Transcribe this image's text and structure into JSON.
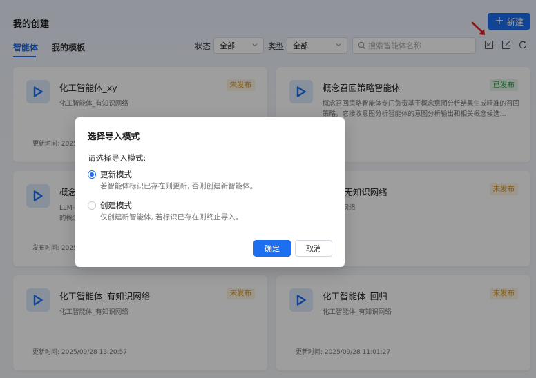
{
  "header": {
    "title": "我的创建",
    "new_button": "新建",
    "tabs": [
      "智能体",
      "我的模板"
    ]
  },
  "filters": {
    "status_label": "状态",
    "status_value": "全部",
    "type_label": "类型",
    "type_value": "全部",
    "search_placeholder": "搜索智能体名称"
  },
  "toolbar_icons": [
    "import-icon",
    "export-icon",
    "refresh-icon"
  ],
  "cards": [
    {
      "name": "化工智能体_xy",
      "badge": "未发布",
      "status": "unpublished",
      "desc": "化工智能体_有知识网络",
      "time": "更新时间: 2025"
    },
    {
      "name": "概念召回策略智能体",
      "badge": "已发布",
      "status": "published",
      "desc": "概念召回策略智能体专门负责基于概念意图分析结果生成精准的召回策略。它接收意图分析智能体的意图分析输出和相关概念候选...",
      "time": "09/28 15:55:57"
    },
    {
      "name": "概念",
      "badge": "",
      "status": "",
      "desc": "LLM-\n的概念",
      "time": "发布时间: 2025"
    },
    {
      "name": "能体_无知识网络",
      "badge": "未发布",
      "status": "unpublished",
      "desc": "无知识网络",
      "time": "09/28 13:22:32"
    },
    {
      "name": "化工智能体_有知识网络",
      "badge": "未发布",
      "status": "unpublished",
      "desc": "化工智能体_有知识网络",
      "time": "更新时间: 2025/09/28 13:20:57"
    },
    {
      "name": "化工智能体_回归",
      "badge": "未发布",
      "status": "unpublished",
      "desc": "化工智能体_有知识网络",
      "time": "更新时间: 2025/09/28 11:01:27"
    }
  ],
  "modal": {
    "title": "选择导入模式",
    "prompt": "请选择导入模式:",
    "options": [
      {
        "label": "更新模式",
        "desc": "若智能体标识已存在则更新, 否则创建新智能体。",
        "checked": true
      },
      {
        "label": "创建模式",
        "desc": "仅创建新智能体, 若标识已存在则终止导入。",
        "checked": false
      }
    ],
    "ok": "确定",
    "cancel": "取消"
  },
  "colors": {
    "primary": "#1d6ef0",
    "unpublished": "#d9911e",
    "published": "#33a14a",
    "annotation_arrow": "#e02020"
  }
}
